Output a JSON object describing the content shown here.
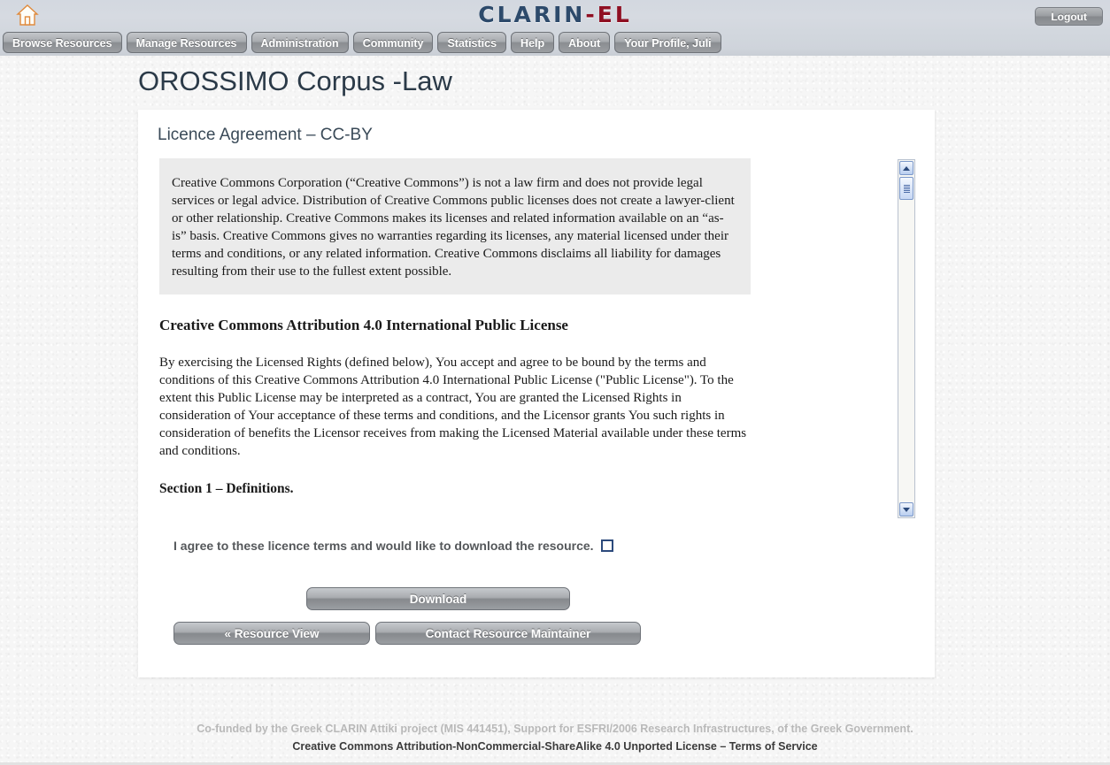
{
  "header": {
    "home_icon": "home-icon",
    "logo_primary": "CLARIN",
    "logo_secondary": "-EL",
    "logout_label": "Logout",
    "logo_color_primary": "#2d4a6b",
    "logo_color_secondary": "#8f0f22"
  },
  "nav": {
    "items": [
      {
        "label": "Browse Resources"
      },
      {
        "label": "Manage Resources"
      },
      {
        "label": "Administration"
      },
      {
        "label": "Community"
      },
      {
        "label": "Statistics"
      },
      {
        "label": "Help"
      },
      {
        "label": "About"
      },
      {
        "label": "Your Profile, Juli"
      }
    ]
  },
  "page": {
    "title": "OROSSIMO Corpus -Law"
  },
  "card": {
    "title": "Licence Agreement – CC-BY",
    "licence": {
      "disclaimer": "Creative Commons Corporation (“Creative Commons”) is not a law firm and does not provide legal services or legal advice. Distribution of Creative Commons public licenses does not create a lawyer-client or other relationship. Creative Commons makes its licenses and related information available on an “as-is” basis. Creative Commons gives no warranties regarding its licenses, any material licensed under their terms and conditions, or any related information. Creative Commons disclaims all liability for damages resulting from their use to the fullest extent possible.",
      "heading": "Creative Commons Attribution 4.0 International Public License",
      "body": "By exercising the Licensed Rights (defined below), You accept and agree to be bound by the terms and conditions of this Creative Commons Attribution 4.0 International Public License (\"Public License\"). To the extent this Public License may be interpreted as a contract, You are granted the Licensed Rights in consideration of Your acceptance of these terms and conditions, and the Licensor grants You such rights in consideration of benefits the Licensor receives from making the Licensed Material available under these terms and conditions.",
      "section_heading": "Section 1 – Definitions."
    },
    "agree": {
      "label": "I agree to these licence terms and would like to download the resource.",
      "checked": false
    },
    "buttons": {
      "download": "Download",
      "resource_view": "« Resource View",
      "contact_maintainer": "Contact Resource Maintainer"
    }
  },
  "footer": {
    "line1": "Co-funded by the Greek CLARIN Attiki project (MIS 441451), Support for ESFRI/2006 Research Infrastructures, of the Greek Government.",
    "licence_link": "Creative Commons Attribution-NonCommercial-ShareAlike 4.0 Unported License",
    "separator": " – ",
    "terms_link": "Terms of Service"
  }
}
